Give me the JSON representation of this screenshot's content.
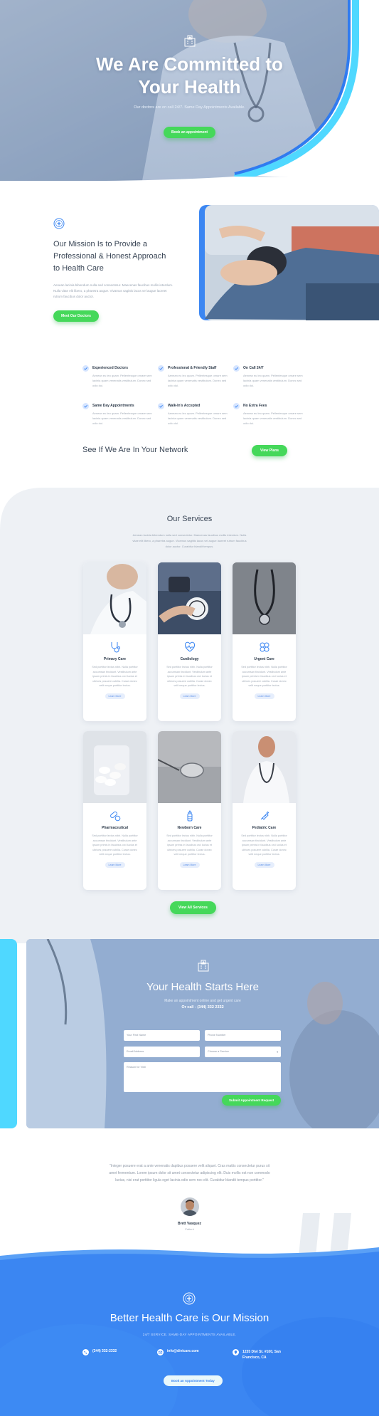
{
  "hero": {
    "title": "We Are Committed to Your Health",
    "subtitle": "Our doctors are on call 24/7. Same Day Appointments Available.",
    "cta_label": "Book an appointment"
  },
  "mission": {
    "title": "Our Mission Is to Provide a Professional & Honest Approach to Health Care",
    "text": "Aenean lacinia bibendum nulla sed consectetur. Maecenas faucibus mollis interdum. Nulla vitae elit libero, a pharetra augue. Vivamus sagittis lacus vel augue laoreet rutrum faucibus dolor auctor.",
    "cta_label": "Meet Our Doctors"
  },
  "features": [
    {
      "title": "Experienced Doctors",
      "text": "Aenean eu leo quam. Pellentesque ornare sem lacinia quam venenatis vestibulum. Donec sed odio dui."
    },
    {
      "title": "Professional & Friendly Staff",
      "text": "Aenean eu leo quam. Pellentesque ornare sem lacinia quam venenatis vestibulum. Donec sed odio dui."
    },
    {
      "title": "On Call 24/7",
      "text": "Aenean eu leo quam. Pellentesque ornare sem lacinia quam venenatis vestibulum. Donec sed odio dui."
    },
    {
      "title": "Same Day Appointments",
      "text": "Aenean eu leo quam. Pellentesque ornare sem lacinia quam venenatis vestibulum. Donec sed odio dui."
    },
    {
      "title": "Walk-In's Accepted",
      "text": "Aenean eu leo quam. Pellentesque ornare sem lacinia quam venenatis vestibulum. Donec sed odio dui."
    },
    {
      "title": "No Extra Fees",
      "text": "Aenean eu leo quam. Pellentesque ornare sem lacinia quam venenatis vestibulum. Donec sed odio dui."
    }
  ],
  "network": {
    "title": "See If We Are In Your Network",
    "cta_label": "View Plans"
  },
  "services": {
    "title": "Our Services",
    "text": "Aenean lacinia bibendum nulla sed consectetur. Maecenas faucibus mollis interdum. Nulla vitae elit libero, a pharetra augue. Vivamus sagittis lacus vel augue laoreet rutrum faucibus dolor auctor. Curabitur blandit tempus.",
    "items": [
      {
        "title": "Primary Care",
        "icon": "stethoscope-icon",
        "text": "Sed porttitor lectus nibh. Nulla porttitor accumsan tincidunt. Vestibulum ante ipsum primis in faucibus orci luctus et ultrices posuere cubilia. Curae donec velit neque porttitor lectus.",
        "button": "Learn More"
      },
      {
        "title": "Cardiology",
        "icon": "heart-pulse-icon",
        "text": "Sed porttitor lectus nibh. Nulla porttitor accumsan tincidunt. Vestibulum ante ipsum primis in faucibus orci luctus et ultrices posuere cubilia. Curae donec velit neque porttitor lectus.",
        "button": "Learn More"
      },
      {
        "title": "Urgent Care",
        "icon": "cross-icon",
        "text": "Sed porttitor lectus nibh. Nulla porttitor accumsan tincidunt. Vestibulum ante ipsum primis in faucibus orci luctus et ultrices posuere cubilia. Curae donec velit neque porttitor lectus.",
        "button": "Learn More"
      },
      {
        "title": "Pharmaceutical",
        "icon": "pills-icon",
        "text": "Sed porttitor lectus nibh. Nulla porttitor accumsan tincidunt. Vestibulum ante ipsum primis in faucibus orci luctus et ultrices posuere cubilia. Curae donec velit neque porttitor lectus.",
        "button": "Learn More"
      },
      {
        "title": "Newborn Care",
        "icon": "baby-bottle-icon",
        "text": "Sed porttitor lectus nibh. Nulla porttitor accumsan tincidunt. Vestibulum ante ipsum primis in faucibus orci luctus et ultrices posuere cubilia. Curae donec velit neque porttitor lectus.",
        "button": "Learn More"
      },
      {
        "title": "Pediatric Care",
        "icon": "syringe-icon",
        "text": "Sed porttitor lectus nibh. Nulla porttitor accumsan tincidunt. Vestibulum ante ipsum primis in faucibus orci luctus et ultrices posuere cubilia. Curae donec velit neque porttitor lectus.",
        "button": "Learn More"
      }
    ],
    "cta_label": "View All Services"
  },
  "contact": {
    "title": "Your Health Starts Here",
    "subtitle": "Make an appointment online and get urgent care",
    "phone_line": "Or call - (344) 332 2332",
    "fields": {
      "first_name": "Your First Name",
      "phone": "Phone Number",
      "email": "Email Address",
      "service": "Choose a Service",
      "reason": "Reason for Visit"
    },
    "submit_label": "Submit Appointment Request"
  },
  "testimonial": {
    "quote": "\"Integer posuere erat a ante venenatis dapibus posuere velit aliquet. Cras mattis consectetur purus sit amet fermentum. Lorem ipsum dolor sit amet consectetur adipiscing elit. Duis mollis est non commodo luctus, nisi erat porttitor ligula eget lacinia odio sem nec elit. Curabitur blandit tempus porttitor.\"",
    "name": "Brett Vasquez",
    "role": "Patient"
  },
  "footer": {
    "title": "Better Health Care is Our Mission",
    "subtitle": "24/7 SERVICE. SAME-DAY APPOINTMENTS AVAILABLE.",
    "phone": "(344) 332-2332",
    "email": "info@divicare.com",
    "address": "1235 Divi St. #100, San Francisco, CA",
    "cta_label": "Book an Appointment Today"
  },
  "colors": {
    "accent_green": "#45d85a",
    "accent_blue": "#3b86f2",
    "accent_cyan": "#4fd8ff",
    "text_dark": "#2d3a4a"
  }
}
